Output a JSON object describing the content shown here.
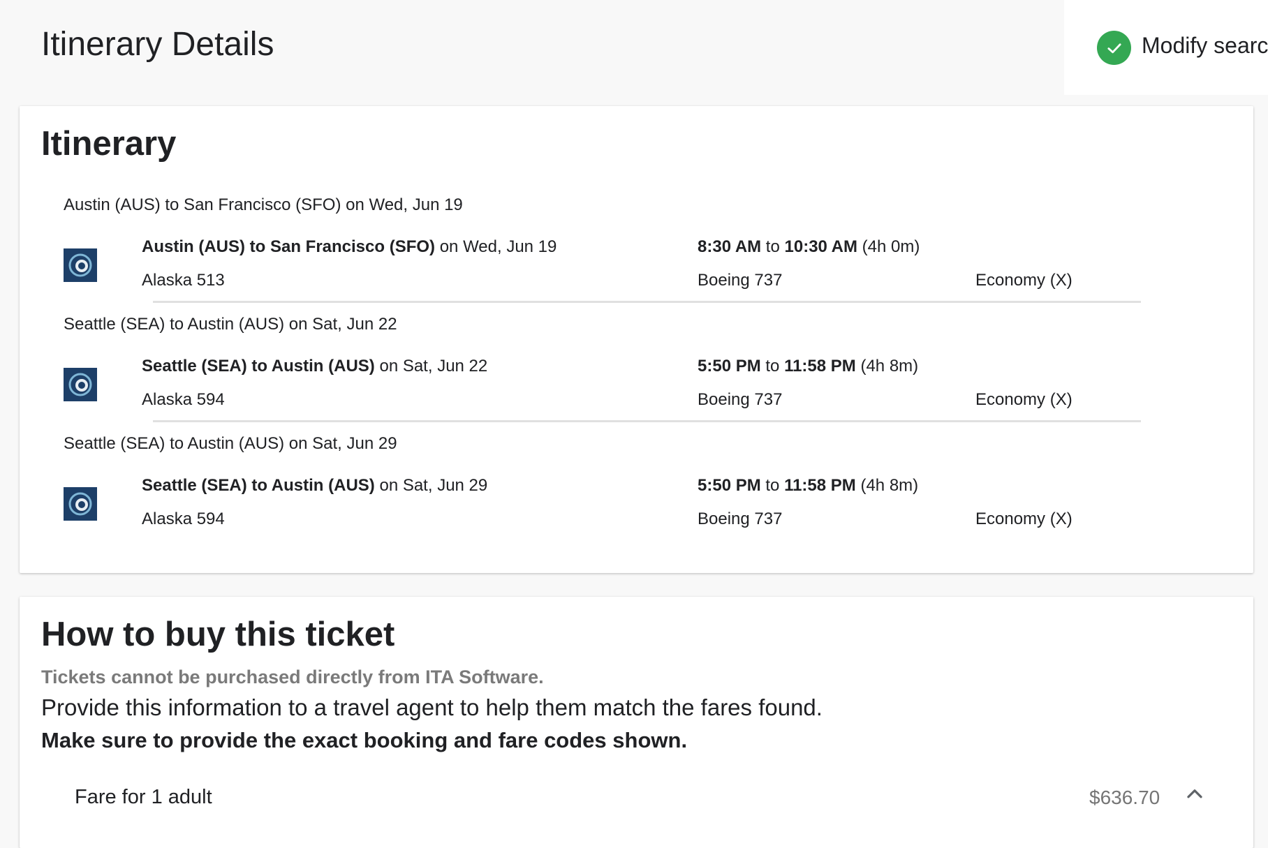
{
  "header": {
    "title": "Itinerary Details",
    "modify_label": "Modify searc"
  },
  "itinerary": {
    "title": "Itinerary",
    "slices": [
      {
        "header": "Austin (AUS) to San Francisco (SFO) on Wed, Jun 19",
        "route_bold": "Austin (AUS) to San Francisco (SFO)",
        "route_date": " on Wed, Jun 19",
        "depart": "8:30 AM",
        "to_word": " to ",
        "arrive": "10:30 AM",
        "duration": " (4h 0m)",
        "flight": "Alaska 513",
        "aircraft": "Boeing 737",
        "cabin": "Economy (X)"
      },
      {
        "header": "Seattle (SEA) to Austin (AUS) on Sat, Jun 22",
        "route_bold": "Seattle (SEA) to Austin (AUS)",
        "route_date": " on Sat, Jun 22",
        "depart": "5:50 PM",
        "to_word": " to ",
        "arrive": "11:58 PM",
        "duration": " (4h 8m)",
        "flight": "Alaska 594",
        "aircraft": "Boeing 737",
        "cabin": "Economy (X)"
      },
      {
        "header": "Seattle (SEA) to Austin (AUS) on Sat, Jun 29",
        "route_bold": "Seattle (SEA) to Austin (AUS)",
        "route_date": " on Sat, Jun 29",
        "depart": "5:50 PM",
        "to_word": " to ",
        "arrive": "11:58 PM",
        "duration": " (4h 8m)",
        "flight": "Alaska 594",
        "aircraft": "Boeing 737",
        "cabin": "Economy (X)"
      }
    ]
  },
  "buy": {
    "title": "How to buy this ticket",
    "note": "Tickets cannot be purchased directly from ITA Software.",
    "instruction": "Provide this information to a travel agent to help them match the fares found.",
    "emphasis": "Make sure to provide the exact booking and fare codes shown.",
    "fare_label": "Fare for 1 adult",
    "fare_amount": "$636.70"
  },
  "colors": {
    "accent_check": "#34a853",
    "airline_logo_bg": "#1d3f68"
  },
  "icons": {
    "modify": "check-circle-icon",
    "airline": "alaska-airlines-logo",
    "fare_toggle": "chevron-up-icon"
  }
}
